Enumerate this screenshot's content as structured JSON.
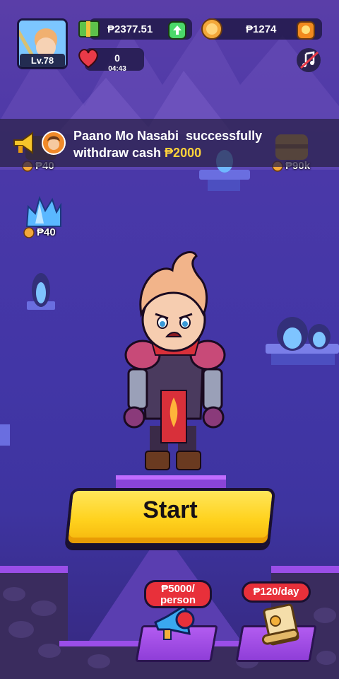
{
  "profile": {
    "level": "Lv.78"
  },
  "currency": {
    "cash_amount": "₱2377.51",
    "coin_amount": "₱1274"
  },
  "lives": {
    "count": "0",
    "timer": "04:43"
  },
  "notification": {
    "line1": "Paano Mo Nasabi  successfully",
    "line2_prefix": "withdraw cash ",
    "amount": "₱2000"
  },
  "rewards": {
    "left_top_price": "₱40",
    "right_top_price": "₱90k",
    "crystal_price": "₱40"
  },
  "actions": {
    "start_label": "Start"
  },
  "bottom": {
    "referral_tag_line1": "₱5000/",
    "referral_tag_line2": "person",
    "daily_tag": "₱120/day"
  },
  "colors": {
    "start_button": "#ffd21e",
    "tag_red": "#e8303a",
    "amount_gold": "#ffd23a"
  }
}
